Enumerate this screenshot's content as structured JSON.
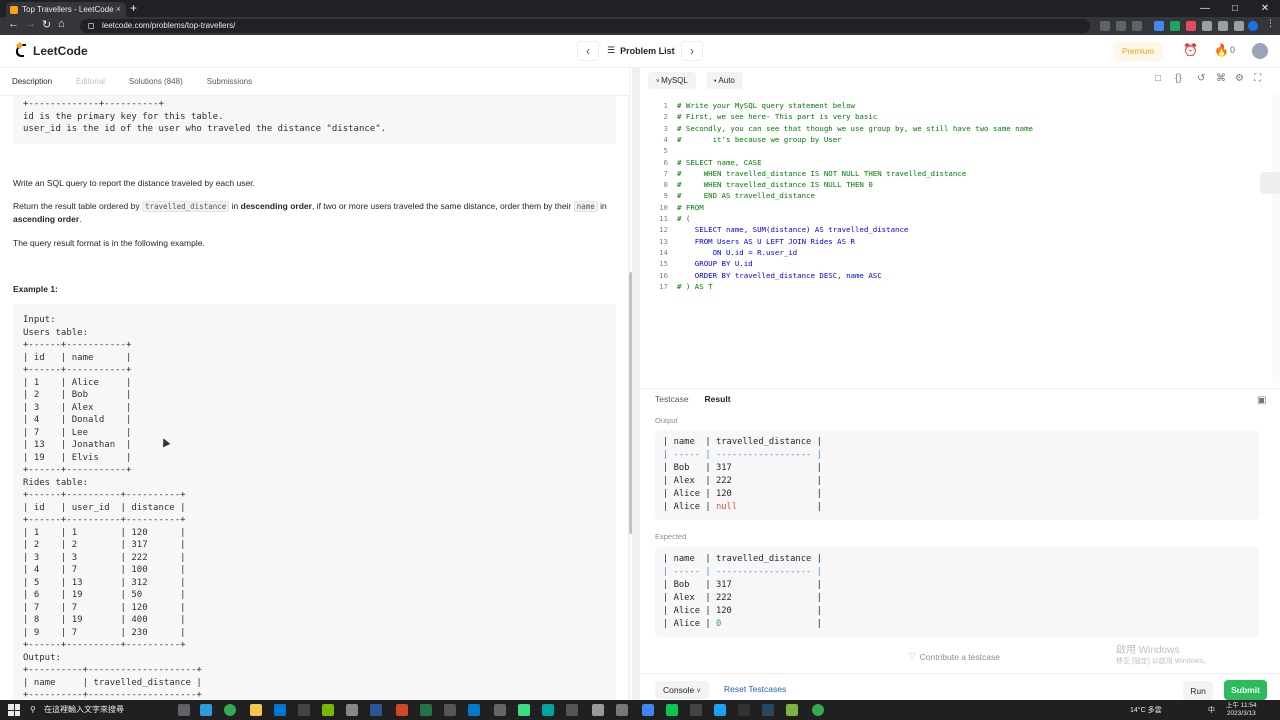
{
  "browser": {
    "tab_title": "Top Travellers - LeetCode",
    "url": "leetcode.com/problems/top-travellers/",
    "new_tab": "+",
    "tab_close": "×"
  },
  "header": {
    "logo_text": "LeetCode",
    "problem_list": "Problem List",
    "premium": "Premium",
    "streak_count": "0"
  },
  "left_tabs": [
    {
      "label": "Description"
    },
    {
      "label": "Editorial"
    },
    {
      "label": "Solutions (848)"
    },
    {
      "label": "Submissions"
    }
  ],
  "description": {
    "table_tail": "+-------------+----------+\nid is the primary key for this table.\nuser_id is the id of the user who traveled the distance \"distance\".",
    "task": "Write an SQL query to report the distance traveled by each user.",
    "order_1": "Return the result table ordered by ",
    "order_code_1": "travelled_distance",
    "order_2": " in ",
    "order_bold_1": "descending order",
    "order_3": ", if two or more users traveled the same distance, order them by their ",
    "order_code_2": "name",
    "order_4": " in ",
    "order_bold_2": "ascending order",
    "order_5": ".",
    "format": "The query result format is in the following example.",
    "example_heading": "Example 1:",
    "example_block": "Input:\nUsers table:\n+------+-----------+\n| id   | name      |\n+------+-----------+\n| 1    | Alice     |\n| 2    | Bob       |\n| 3    | Alex      |\n| 4    | Donald    |\n| 7    | Lee       |\n| 13   | Jonathan  |\n| 19   | Elvis     |\n+------+-----------+\nRides table:\n+------+----------+----------+\n| id   | user_id  | distance |\n+------+----------+----------+\n| 1    | 1        | 120      |\n| 2    | 2        | 317      |\n| 3    | 3        | 222      |\n| 4    | 7        | 100      |\n| 5    | 13       | 312      |\n| 6    | 19       | 50       |\n| 7    | 7        | 120      |\n| 8    | 19       | 400      |\n| 9    | 7        | 230      |\n+------+----------+----------+\nOutput:\n+----------+--------------------+\n| name     | travelled_distance |\n+----------+--------------------+"
  },
  "editor": {
    "language": "MySQL",
    "mode": "Auto",
    "lines": [
      "# Write your MySQL query statement below",
      "# First, we see here- This part is very basic",
      "# Secondly, you can see that though we use group by, we still have two same name",
      "#       it's because we group by User",
      "",
      "# SELECT name, CASE",
      "#     WHEN travelled_distance IS NOT NULL THEN travelled_distance",
      "#     WHEN travelled_distance IS NULL THEN 0",
      "#     END AS travelled_distance",
      "# FROM",
      "# (",
      "    SELECT name, SUM(distance) AS travelled_distance",
      "    FROM Users AS U LEFT JOIN Rides AS R",
      "        ON U.id = R.user_id",
      "    GROUP BY U.id",
      "    ORDER BY travelled_distance DESC, name ASC",
      "# ) AS T"
    ]
  },
  "result": {
    "tabs": [
      "Testcase",
      "Result"
    ],
    "output_label": "Output",
    "expected_label": "Expected",
    "header_row": "| name  | travelled_distance |",
    "sep_row": "| ----- | ------------------ |",
    "output_rows": [
      {
        "name": "Bob  ",
        "value": "317",
        "pad": "                "
      },
      {
        "name": "Alex ",
        "value": "222",
        "pad": "                "
      },
      {
        "name": "Alice",
        "value": "120",
        "pad": "                "
      },
      {
        "name": "Alice",
        "value": "null",
        "pad": "               ",
        "is_null": true
      }
    ],
    "expected_rows": [
      {
        "name": "Bob  ",
        "value": "317",
        "pad": "                "
      },
      {
        "name": "Alex ",
        "value": "222",
        "pad": "                "
      },
      {
        "name": "Alice",
        "value": "120",
        "pad": "                "
      },
      {
        "name": "Alice",
        "value": "0",
        "pad": "                  ",
        "is_zero": true
      }
    ],
    "contribute": "Contribute a testcase",
    "console": "Console",
    "reset": "Reset Testcases",
    "run": "Run",
    "submit": "Submit"
  },
  "watermark": {
    "line1": "啟用 Windows",
    "line2": "移至 [設定] 以啟用 Windows。"
  },
  "taskbar": {
    "search_placeholder": "在這裡輸入文字來搜尋",
    "weather": "14°C 多雲",
    "ime": "中",
    "time": "上午 11:54",
    "date": "2023/3/13"
  },
  "colors": {
    "accent": "#ffa116",
    "submit": "#2cbb5d",
    "comment": "#008000",
    "keyword": "#0000ff",
    "null": "#e8523f"
  }
}
